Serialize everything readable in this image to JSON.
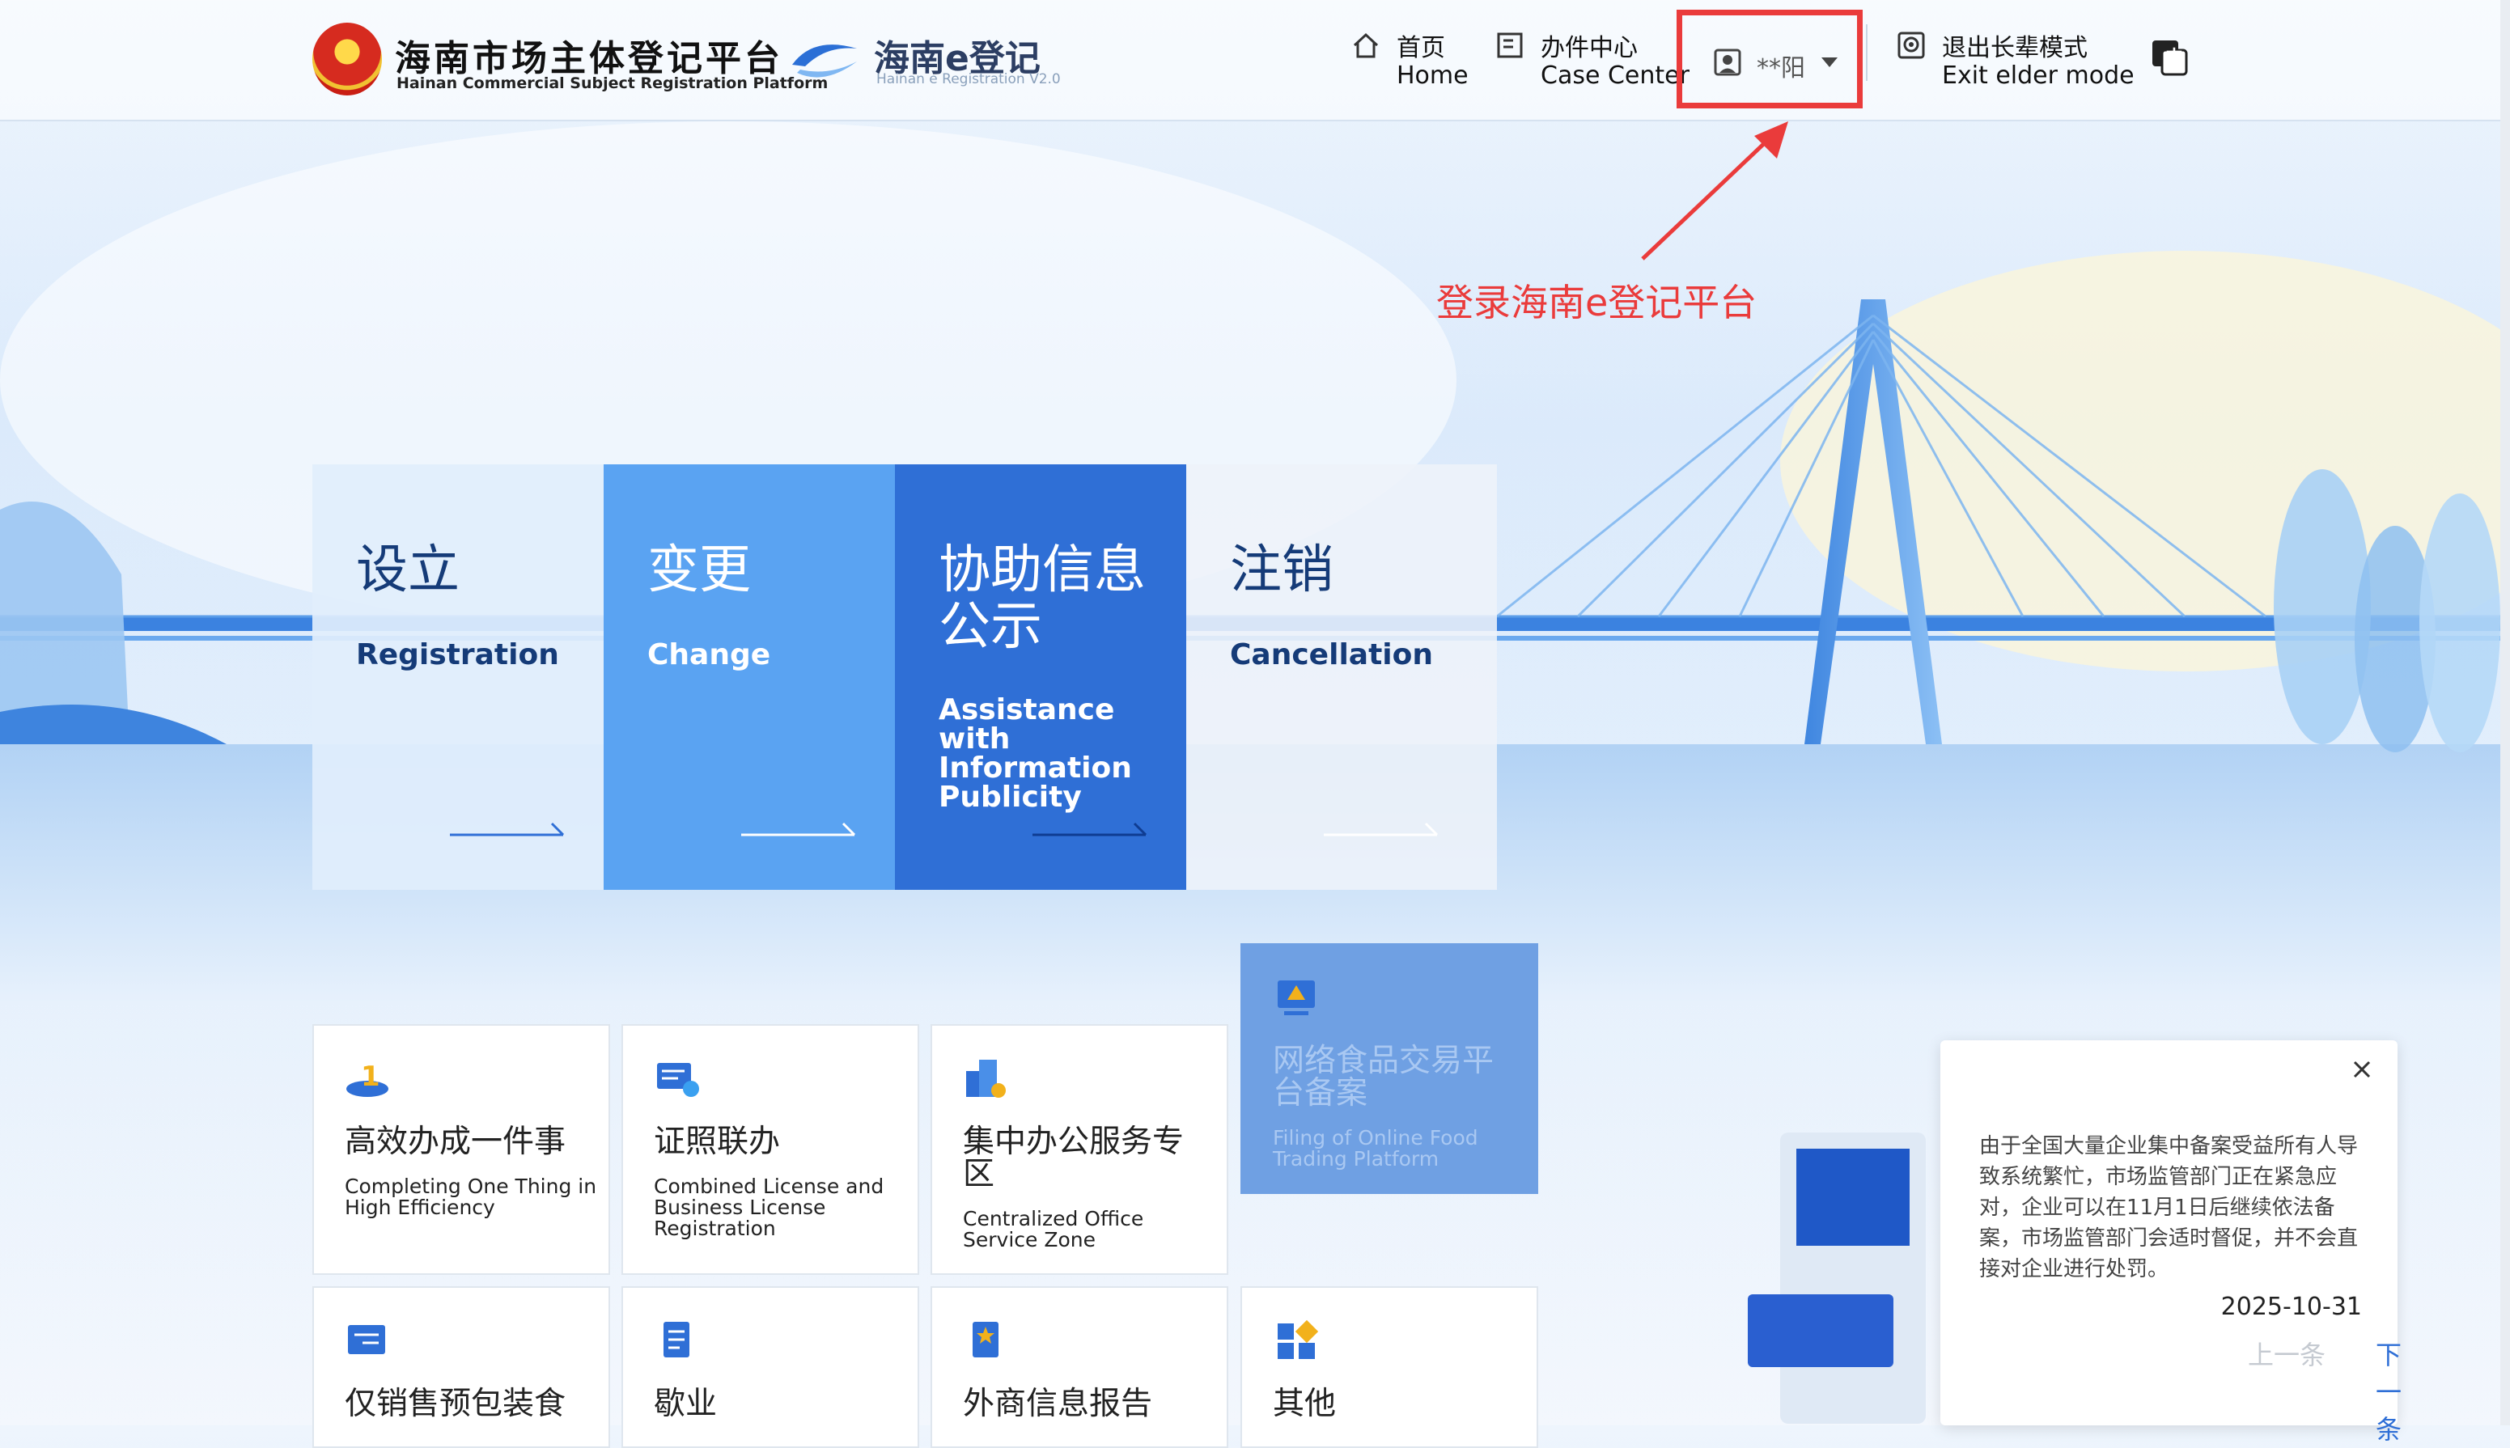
{
  "header": {
    "brand_cn": "海南市场主体登记平台",
    "brand_en": "Hainan Commercial Subject Registration Platform",
    "elogo_cn": "海南e登记",
    "elogo_en": "Hainan e Registration V2.0",
    "nav": [
      {
        "cn": "首页",
        "en": "Home",
        "icon": "home-icon"
      },
      {
        "cn": "办件中心",
        "en": "Case Center",
        "icon": "document-icon"
      }
    ],
    "user_name": "**阳",
    "elder": {
      "cn": "退出长辈模式",
      "en": "Exit elder mode",
      "icon": "elder-mode-icon"
    },
    "lang_icon": "language-switch-icon"
  },
  "annotation": {
    "text": "登录海南e登记平台",
    "color": "#ea3b3b"
  },
  "categories": [
    {
      "cn": "设立",
      "en": "Registration"
    },
    {
      "cn": "变更",
      "en": "Change"
    },
    {
      "cn": "协助信息\n公示",
      "en": "Assistance\nwith\nInformation\nPublicity"
    },
    {
      "cn": "注销",
      "en": "Cancellation"
    }
  ],
  "tiles": [
    {
      "cn": "高效办成一件事",
      "en": "Completing One Thing in High Efficiency",
      "icon": "efficiency-icon"
    },
    {
      "cn": "证照联办",
      "en": "Combined License and Business License Registration",
      "icon": "license-icon"
    },
    {
      "cn": "集中办公服务专区",
      "en": "Centralized Office Service Zone",
      "icon": "office-building-icon"
    },
    {
      "cn": "网络食品交易平台备案",
      "en": "Filing of Online Food Trading Platform",
      "icon": "food-platform-icon"
    },
    {
      "cn": "仅销售预包装食",
      "en": "",
      "icon": "packaged-food-icon"
    },
    {
      "cn": "歇业",
      "en": "",
      "icon": "suspension-icon"
    },
    {
      "cn": "外商信息报告",
      "en": "",
      "icon": "foreign-report-icon"
    },
    {
      "cn": "其他",
      "en": "",
      "icon": "other-icon"
    }
  ],
  "notice": {
    "body": "由于全国大量企业集中备案受益所有人导致系统繁忙，市场监管部门正在紧急应对，企业可以在11月1日后继续依法备案，市场监管部门会适时督促，并不会直接对企业进行处罚。",
    "date": "2025-10-31",
    "prev": "上一条",
    "next": "下一条"
  },
  "colors": {
    "accent": "#2f6fd6",
    "highlight": "#ea3b3b",
    "card_dark": "#2f6fd6",
    "card_mid": "#5aa3f2"
  }
}
